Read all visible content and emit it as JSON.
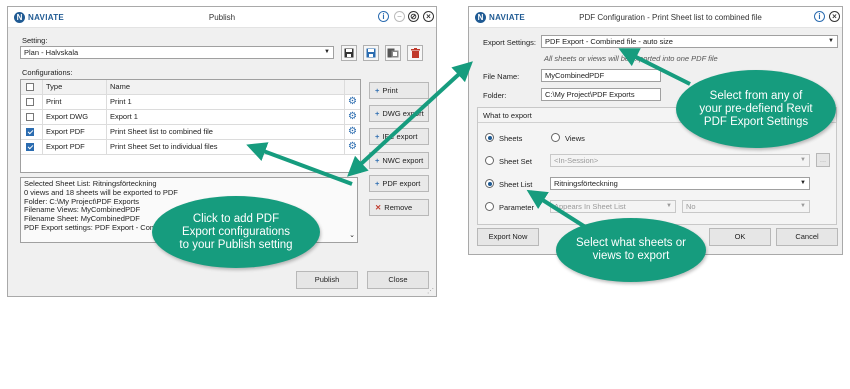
{
  "publish": {
    "title": "Publish",
    "setting_label": "Setting:",
    "setting_value": "Plan - Halvskala",
    "configurations_label": "Configurations:",
    "columns": [
      "Type",
      "Name"
    ],
    "rows": [
      {
        "checked": false,
        "type": "Print",
        "name": "Print 1"
      },
      {
        "checked": false,
        "type": "Export DWG",
        "name": "Export 1"
      },
      {
        "checked": true,
        "type": "Export PDF",
        "name": "Print Sheet list to combined file"
      },
      {
        "checked": true,
        "type": "Export PDF",
        "name": "Print Sheet Set to individual files"
      }
    ],
    "status_lines": [
      "Selected Sheet List: Ritningsförteckning",
      "0 views and 18 sheets will be exported to PDF",
      "Folder: C:\\My Project\\PDF Exports",
      "Filename Views: MyCombinedPDF",
      "Filename Sheet: MyCombinedPDF",
      "PDF Export settings: PDF Export - Comb"
    ],
    "side_buttons": {
      "print": "Print",
      "dwg": "DWG export",
      "ifc": "IFC export",
      "nwc": "NWC export",
      "pdf": "PDF export",
      "remove": "Remove"
    },
    "publish_button": "Publish",
    "close_button": "Close"
  },
  "pdfconfig": {
    "title": "PDF Configuration - Print Sheet list to combined file",
    "export_settings_label": "Export Settings:",
    "export_settings_value": "PDF Export - Combined file - auto size",
    "hint": "All sheets or views will be exported into one PDF file",
    "file_name_label": "File Name:",
    "file_name_value": "MyCombinedPDF",
    "folder_label": "Folder:",
    "folder_value": "C:\\My Project\\PDF Exports",
    "what_to_export_label": "What to export",
    "sheets_label": "Sheets",
    "views_label": "Views",
    "sheet_set_label": "Sheet Set",
    "sheet_set_value": "<In-Session>",
    "sheet_list_label": "Sheet List",
    "sheet_list_value": "Ritningsförteckning",
    "parameter_label": "Parameter",
    "parameter_value": "Appears In Sheet List",
    "parameter_value2": "No",
    "export_now_button": "Export Now",
    "ok_button": "OK",
    "cancel_button": "Cancel"
  },
  "callouts": {
    "left": "Click to add PDF Export configurations to your Publish setting",
    "right_top": "Select from any of your pre-defiend Revit PDF Export Settings",
    "right_bottom": "Select what sheets or views to export"
  },
  "colors": {
    "accent": "#169c7e",
    "brand": "#1f5a93",
    "delete": "#c0392b"
  }
}
